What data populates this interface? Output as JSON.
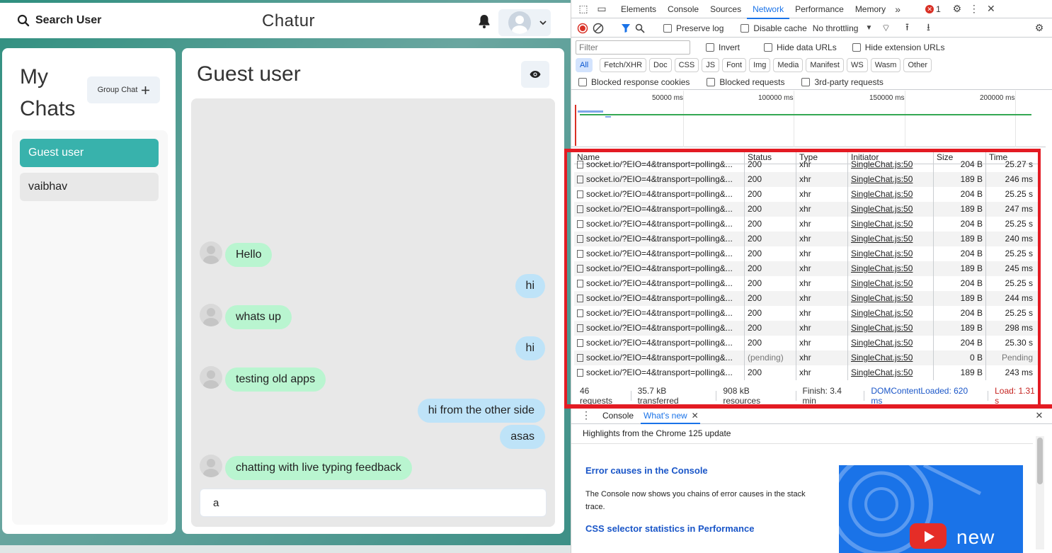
{
  "app": {
    "search_label": "Search User",
    "title": "Chatur",
    "my_chats_title": "My Chats",
    "group_chat_label": "Group Chat",
    "chats": [
      "Guest user",
      "vaibhav"
    ],
    "chat_title": "Guest user",
    "messages": [
      {
        "text": "Hello",
        "side": "in"
      },
      {
        "text": "hi",
        "side": "out"
      },
      {
        "text": "whats up",
        "side": "in"
      },
      {
        "text": "hi",
        "side": "out"
      },
      {
        "text": "testing old apps",
        "side": "in"
      },
      {
        "text": "hi from the other side",
        "side": "out"
      },
      {
        "text": "asas",
        "side": "out"
      },
      {
        "text": "chatting with live typing feedback",
        "side": "in"
      }
    ],
    "input_value": "a",
    "colors": {
      "active_chat": "#38b2ac",
      "incoming": "#b9f5d0",
      "outgoing": "#bee3f8"
    }
  },
  "devtools": {
    "tabs": [
      "Elements",
      "Console",
      "Sources",
      "Network",
      "Performance",
      "Memory"
    ],
    "active_tab": "Network",
    "error_count": "1",
    "toolbar": {
      "preserve_log": "Preserve log",
      "disable_cache": "Disable cache",
      "throttling": "No throttling"
    },
    "filter_placeholder": "Filter",
    "filter_options": [
      "Invert",
      "Hide data URLs",
      "Hide extension URLs"
    ],
    "type_chips": [
      "All",
      "Fetch/XHR",
      "Doc",
      "CSS",
      "JS",
      "Font",
      "Img",
      "Media",
      "Manifest",
      "WS",
      "Wasm",
      "Other"
    ],
    "block_options": [
      "Blocked response cookies",
      "Blocked requests",
      "3rd-party requests"
    ],
    "overview_ticks": [
      "50000 ms",
      "100000 ms",
      "150000 ms",
      "200000 ms"
    ],
    "columns": [
      "Name",
      "Status",
      "Type",
      "Initiator",
      "Size",
      "Time"
    ],
    "rows": [
      {
        "name": "socket.io/?EIO=4&transport=polling&...",
        "status": "200",
        "type": "xhr",
        "initiator": "SingleChat.js:50",
        "size": "204 B",
        "time": "25.27 s"
      },
      {
        "name": "socket.io/?EIO=4&transport=polling&...",
        "status": "200",
        "type": "xhr",
        "initiator": "SingleChat.js:50",
        "size": "189 B",
        "time": "246 ms"
      },
      {
        "name": "socket.io/?EIO=4&transport=polling&...",
        "status": "200",
        "type": "xhr",
        "initiator": "SingleChat.js:50",
        "size": "204 B",
        "time": "25.25 s"
      },
      {
        "name": "socket.io/?EIO=4&transport=polling&...",
        "status": "200",
        "type": "xhr",
        "initiator": "SingleChat.js:50",
        "size": "189 B",
        "time": "247 ms"
      },
      {
        "name": "socket.io/?EIO=4&transport=polling&...",
        "status": "200",
        "type": "xhr",
        "initiator": "SingleChat.js:50",
        "size": "204 B",
        "time": "25.25 s"
      },
      {
        "name": "socket.io/?EIO=4&transport=polling&...",
        "status": "200",
        "type": "xhr",
        "initiator": "SingleChat.js:50",
        "size": "189 B",
        "time": "240 ms"
      },
      {
        "name": "socket.io/?EIO=4&transport=polling&...",
        "status": "200",
        "type": "xhr",
        "initiator": "SingleChat.js:50",
        "size": "204 B",
        "time": "25.25 s"
      },
      {
        "name": "socket.io/?EIO=4&transport=polling&...",
        "status": "200",
        "type": "xhr",
        "initiator": "SingleChat.js:50",
        "size": "189 B",
        "time": "245 ms"
      },
      {
        "name": "socket.io/?EIO=4&transport=polling&...",
        "status": "200",
        "type": "xhr",
        "initiator": "SingleChat.js:50",
        "size": "204 B",
        "time": "25.25 s"
      },
      {
        "name": "socket.io/?EIO=4&transport=polling&...",
        "status": "200",
        "type": "xhr",
        "initiator": "SingleChat.js:50",
        "size": "189 B",
        "time": "244 ms"
      },
      {
        "name": "socket.io/?EIO=4&transport=polling&...",
        "status": "200",
        "type": "xhr",
        "initiator": "SingleChat.js:50",
        "size": "204 B",
        "time": "25.25 s"
      },
      {
        "name": "socket.io/?EIO=4&transport=polling&...",
        "status": "200",
        "type": "xhr",
        "initiator": "SingleChat.js:50",
        "size": "189 B",
        "time": "298 ms"
      },
      {
        "name": "socket.io/?EIO=4&transport=polling&...",
        "status": "200",
        "type": "xhr",
        "initiator": "SingleChat.js:50",
        "size": "204 B",
        "time": "25.30 s"
      },
      {
        "name": "socket.io/?EIO=4&transport=polling&...",
        "status": "(pending)",
        "type": "xhr",
        "initiator": "SingleChat.js:50",
        "size": "0 B",
        "time": "Pending"
      },
      {
        "name": "socket.io/?EIO=4&transport=polling&...",
        "status": "200",
        "type": "xhr",
        "initiator": "SingleChat.js:50",
        "size": "189 B",
        "time": "243 ms"
      }
    ],
    "summary": {
      "requests": "46 requests",
      "transferred": "35.7 kB transferred",
      "resources": "908 kB resources",
      "finish": "Finish: 3.4 min",
      "dom_loaded": "DOMContentLoaded: 620 ms",
      "load": "Load: 1.31 s"
    },
    "drawer_tabs": [
      "Console",
      "What's new"
    ],
    "whats_new": {
      "highlights": "Highlights from the Chrome 125 update",
      "h1": "Error causes in the Console",
      "p1": "The Console now shows you chains of error causes in the stack trace.",
      "h2": "CSS selector statistics in Performance",
      "badge": "new"
    }
  }
}
